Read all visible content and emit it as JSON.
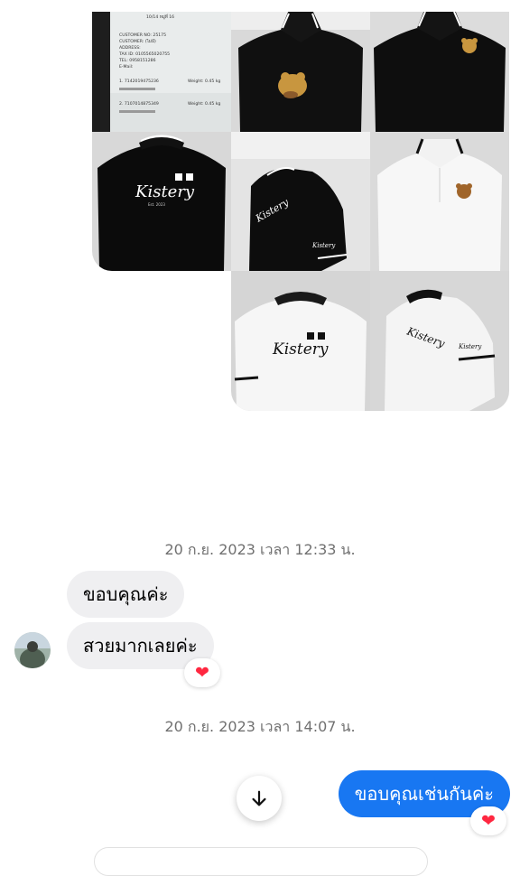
{
  "photos": {
    "receipt_lines": [
      "10/14 หมู่ที่ 16",
      "CUSTOMER NO: 25175",
      "CUSTOMER: (ไม่มี)",
      "ADDRESS:",
      "TAX ID: 0105565020755",
      "TEL: 0958151286",
      "E-Mail:",
      "1. 7142019475236",
      "Weight: 0.45 kg",
      "2. 7107014875349",
      "Weight: 0.45 kg"
    ],
    "brand_text": "Kistery",
    "brand_subtext": "Est. 2023"
  },
  "chat": {
    "timestamp_1": "20 ก.ย. 2023 เวลา 12:33 น.",
    "incoming_1": "ขอบคุณค่ะ",
    "incoming_2": "สวยมากเลยค่ะ",
    "reaction_1": "❤",
    "timestamp_2": "20 ก.ย. 2023 เวลา 14:07 น.",
    "outgoing_1": "ขอบคุณเช่นกันค่ะ",
    "reaction_2": "❤"
  },
  "colors": {
    "outgoing_bubble": "#1877f2",
    "incoming_bubble": "#efeff1",
    "timestamp_text": "#707070",
    "reaction_heart": "#ff2740"
  },
  "icons": {
    "scroll_down": "arrow-down-icon",
    "reaction": "heart-icon",
    "avatar": "profile-avatar"
  }
}
